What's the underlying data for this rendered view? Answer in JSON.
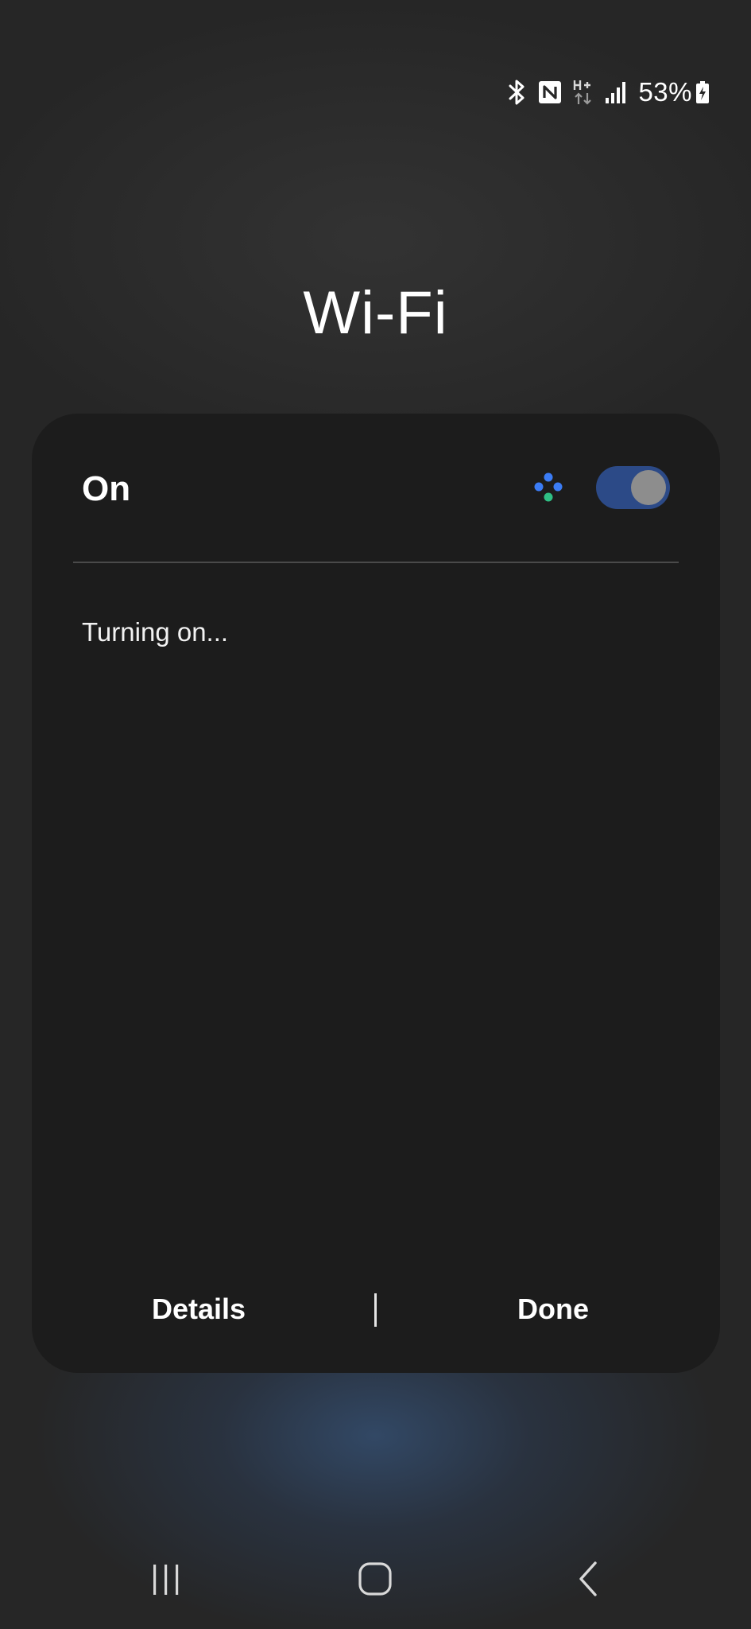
{
  "status_bar": {
    "battery_percent": "53%",
    "icons": [
      "bluetooth-icon",
      "nfc-icon",
      "hplus-data-icon",
      "signal-icon",
      "battery-charging-icon"
    ]
  },
  "page": {
    "title": "Wi-Fi"
  },
  "card": {
    "switch_label": "On",
    "toggle_state": true,
    "toggle_color": "#2c4a87",
    "status_text": "Turning on...",
    "details_label": "Details",
    "done_label": "Done"
  },
  "nav_bar": {
    "icons": [
      "recents-icon",
      "home-icon",
      "back-icon"
    ]
  }
}
